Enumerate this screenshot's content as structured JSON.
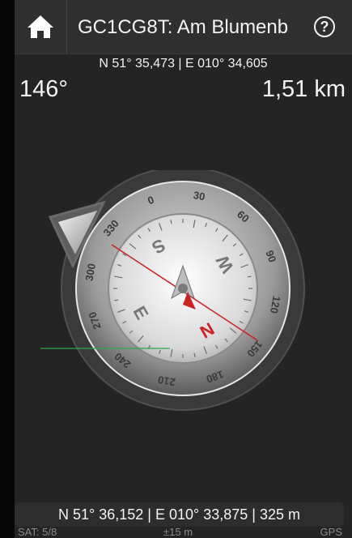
{
  "header": {
    "title": "GC1CG8T: Am Blumenb",
    "help_label": "?"
  },
  "target_coordinates": "N 51° 35,473 | E 010° 34,605",
  "bearing": "146°",
  "distance": "1,51 km",
  "compass": {
    "bezel_labels": [
      "0",
      "30",
      "60",
      "90",
      "120",
      "150",
      "180",
      "210",
      "240",
      "270",
      "300",
      "330"
    ],
    "cardinals": [
      "N",
      "E",
      "S",
      "W"
    ],
    "colors": {
      "needle": "#cc2222",
      "guide_line": "#2ea84a",
      "bezel": "#9a9a9a"
    }
  },
  "current_position": "N 51° 36,152 | E 010° 33,875 | 325 m",
  "footer": {
    "satellites": "SAT: 5/8",
    "accuracy": "±15 m",
    "source": "GPS"
  }
}
